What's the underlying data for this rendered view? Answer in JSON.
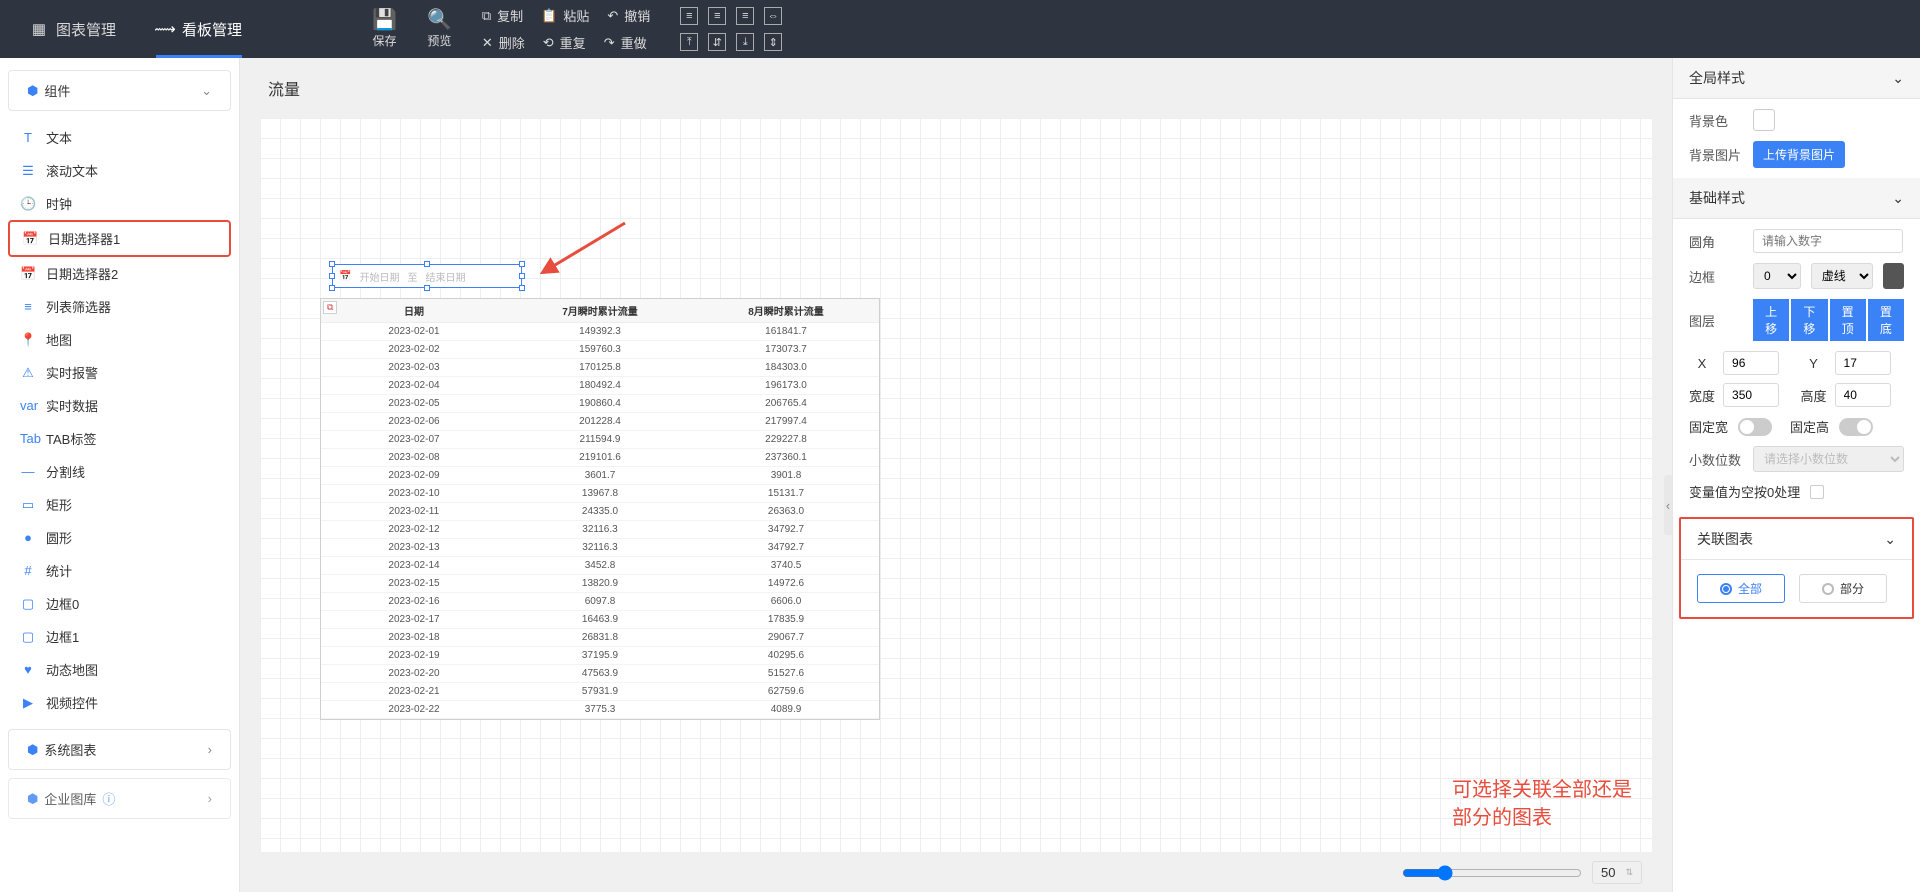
{
  "top_nav": {
    "chart_mgmt": "图表管理",
    "board_mgmt": "看板管理"
  },
  "toolbar": {
    "save": "保存",
    "preview": "预览",
    "copy": "复制",
    "delete": "删除",
    "paste": "粘贴",
    "refresh": "重复",
    "undo": "撤销",
    "redo": "重做"
  },
  "left": {
    "section_components": "组件",
    "section_system_charts": "系统图表",
    "section_enterprise_lib": "企业图库",
    "items": [
      {
        "label": "文本",
        "icon": "T"
      },
      {
        "label": "滚动文本",
        "icon": "☰"
      },
      {
        "label": "时钟",
        "icon": "🕒"
      },
      {
        "label": "日期选择器1",
        "icon": "📅"
      },
      {
        "label": "日期选择器2",
        "icon": "📅"
      },
      {
        "label": "列表筛选器",
        "icon": "≡"
      },
      {
        "label": "地图",
        "icon": "📍"
      },
      {
        "label": "实时报警",
        "icon": "⚠"
      },
      {
        "label": "实时数据",
        "icon": "var"
      },
      {
        "label": "TAB标签",
        "icon": "Tab"
      },
      {
        "label": "分割线",
        "icon": "—"
      },
      {
        "label": "矩形",
        "icon": "▭"
      },
      {
        "label": "圆形",
        "icon": "●"
      },
      {
        "label": "统计",
        "icon": "#"
      },
      {
        "label": "边框0",
        "icon": "▢"
      },
      {
        "label": "边框1",
        "icon": "▢"
      },
      {
        "label": "动态地图",
        "icon": "♥"
      },
      {
        "label": "视频控件",
        "icon": "▶"
      }
    ]
  },
  "canvas": {
    "title": "流量",
    "date_picker": {
      "calendar_icon": "📅",
      "start_ph": "开始日期",
      "sep": "至",
      "end_ph": "结束日期"
    },
    "annotation": "可选择关联全部还是部分的图表",
    "zoom": "50",
    "table": {
      "headers": [
        "日期",
        "7月瞬时累计流量",
        "8月瞬时累计流量"
      ],
      "rows": [
        [
          "2023-02-01",
          "149392.3",
          "161841.7"
        ],
        [
          "2023-02-02",
          "159760.3",
          "173073.7"
        ],
        [
          "2023-02-03",
          "170125.8",
          "184303.0"
        ],
        [
          "2023-02-04",
          "180492.4",
          "196173.0"
        ],
        [
          "2023-02-05",
          "190860.4",
          "206765.4"
        ],
        [
          "2023-02-06",
          "201228.4",
          "217997.4"
        ],
        [
          "2023-02-07",
          "211594.9",
          "229227.8"
        ],
        [
          "2023-02-08",
          "219101.6",
          "237360.1"
        ],
        [
          "2023-02-09",
          "3601.7",
          "3901.8"
        ],
        [
          "2023-02-10",
          "13967.8",
          "15131.7"
        ],
        [
          "2023-02-11",
          "24335.0",
          "26363.0"
        ],
        [
          "2023-02-12",
          "32116.3",
          "34792.7"
        ],
        [
          "2023-02-13",
          "32116.3",
          "34792.7"
        ],
        [
          "2023-02-14",
          "3452.8",
          "3740.5"
        ],
        [
          "2023-02-15",
          "13820.9",
          "14972.6"
        ],
        [
          "2023-02-16",
          "6097.8",
          "6606.0"
        ],
        [
          "2023-02-17",
          "16463.9",
          "17835.9"
        ],
        [
          "2023-02-18",
          "26831.8",
          "29067.7"
        ],
        [
          "2023-02-19",
          "37195.9",
          "40295.6"
        ],
        [
          "2023-02-20",
          "47563.9",
          "51527.6"
        ],
        [
          "2023-02-21",
          "57931.9",
          "62759.6"
        ],
        [
          "2023-02-22",
          "3775.3",
          "4089.9"
        ]
      ]
    }
  },
  "right": {
    "global": {
      "title": "全局样式",
      "bg_color_label": "背景色",
      "bg_image_label": "背景图片",
      "upload_btn": "上传背景图片"
    },
    "basic": {
      "title": "基础样式",
      "radius_label": "圆角",
      "radius_ph": "请输入数字",
      "border_label": "边框",
      "border_width": "0",
      "border_style": "虚线",
      "layer_label": "图层",
      "layer_up": "上移",
      "layer_down": "下移",
      "layer_top": "置顶",
      "layer_bottom": "置底",
      "x_label": "X",
      "x_val": "96",
      "y_label": "Y",
      "y_val": "17",
      "width_label": "宽度",
      "width_val": "350",
      "height_label": "高度",
      "height_val": "40",
      "fixed_w_label": "固定宽",
      "fixed_h_label": "固定高",
      "decimal_label": "小数位数",
      "decimal_ph": "请选择小数位数",
      "zero_label": "变量值为空按0处理"
    },
    "link": {
      "title": "关联图表",
      "opt_all": "全部",
      "opt_part": "部分"
    }
  }
}
